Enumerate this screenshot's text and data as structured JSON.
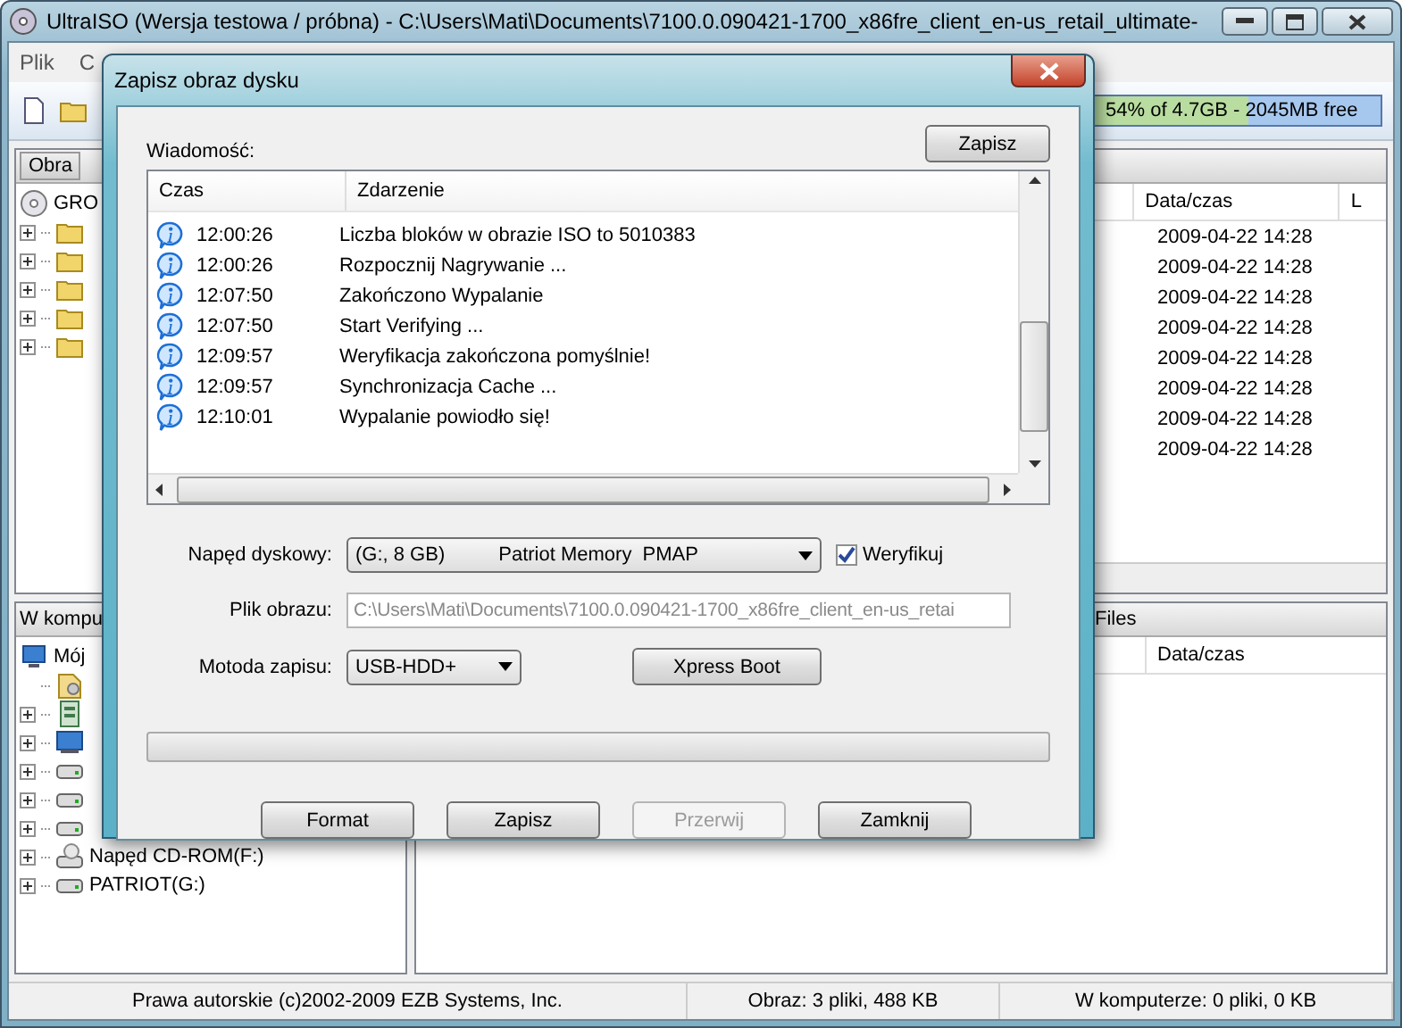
{
  "window": {
    "title": "UltraISO (Wersja testowa / próbna) - C:\\Users\\Mati\\Documents\\7100.0.090421-1700_x86fre_client_en-us_retail_ultimate-"
  },
  "menu": [
    "Plik",
    "C"
  ],
  "capacity": {
    "text": "54% of 4.7GB - 2045MB free",
    "level": 0.54
  },
  "image_panel": {
    "header": "Obra",
    "tree": {
      "label": "GRO",
      "children": [
        {
          "kind": "folder",
          "expandable": true
        },
        {
          "kind": "folder",
          "expandable": true
        },
        {
          "kind": "folder",
          "expandable": true
        },
        {
          "kind": "folder",
          "expandable": true
        },
        {
          "kind": "folder",
          "expandable": true
        }
      ]
    }
  },
  "image_files": {
    "columns": [
      "Data/czas",
      "L"
    ],
    "rows": [
      "2009-04-22 14:28",
      "2009-04-22 14:28",
      "2009-04-22 14:28",
      "2009-04-22 14:28",
      "2009-04-22 14:28",
      "2009-04-22 14:28",
      "2009-04-22 14:28",
      "2009-04-22 14:28"
    ]
  },
  "computer_panel": {
    "header": "W kompu",
    "tree": {
      "label": "Mój",
      "children": [
        {
          "kind": "documents",
          "expandable": false
        },
        {
          "kind": "desktop",
          "expandable": true
        },
        {
          "kind": "monitor",
          "expandable": true
        },
        {
          "kind": "drive",
          "expandable": true
        },
        {
          "kind": "drive",
          "expandable": true
        },
        {
          "kind": "drive",
          "expandable": true
        },
        {
          "kind": "cdrom",
          "expandable": true,
          "label": "Napęd CD-ROM(F:)"
        },
        {
          "kind": "drive",
          "expandable": true,
          "label": "PATRIOT(G:)"
        }
      ]
    }
  },
  "computer_files": {
    "header": "Files",
    "columns": [
      "Data/czas"
    ]
  },
  "status_bar": [
    "Prawa autorskie (c)2002-2009 EZB Systems, Inc.",
    "Obraz: 3 pliki, 488 KB",
    "W komputerze: 0 pliki, 0 KB"
  ],
  "dialog": {
    "title": "Zapisz obraz dysku",
    "log_label": "Wiadomość:",
    "save_log_button": "Zapisz",
    "log_columns": [
      "Czas",
      "Zdarzenie"
    ],
    "log": [
      {
        "time": "12:00:26",
        "event": "Liczba bloków w obrazie ISO to 5010383"
      },
      {
        "time": "12:00:26",
        "event": "Rozpocznij Nagrywanie ..."
      },
      {
        "time": "12:07:50",
        "event": "Zakończono Wypalanie"
      },
      {
        "time": "12:07:50",
        "event": "Start Verifying ..."
      },
      {
        "time": "12:09:57",
        "event": "Weryfikacja zakończona pomyślnie!"
      },
      {
        "time": "12:09:57",
        "event": "Synchronizacja Cache ..."
      },
      {
        "time": "12:10:01",
        "event": "Wypalanie powiodło się!"
      }
    ],
    "drive": {
      "label": "Napęd dyskowy:",
      "value_parts": [
        "(G:, 8 GB)",
        "Patriot Memory  PMAP"
      ]
    },
    "verify": {
      "label": "Weryfikuj",
      "checked": true
    },
    "image_file": {
      "label": "Plik obrazu:",
      "value": "C:\\Users\\Mati\\Documents\\7100.0.090421-1700_x86fre_client_en-us_retai",
      "disabled": true
    },
    "method": {
      "label": "Motoda zapisu:",
      "value": "USB-HDD+"
    },
    "xpress_button": "Xpress Boot",
    "progress": {
      "level": 0
    },
    "buttons": [
      {
        "label": "Format",
        "disabled": false
      },
      {
        "label": "Zapisz",
        "disabled": false
      },
      {
        "label": "Przerwij",
        "disabled": true
      },
      {
        "label": "Zamknij",
        "disabled": false
      }
    ]
  }
}
